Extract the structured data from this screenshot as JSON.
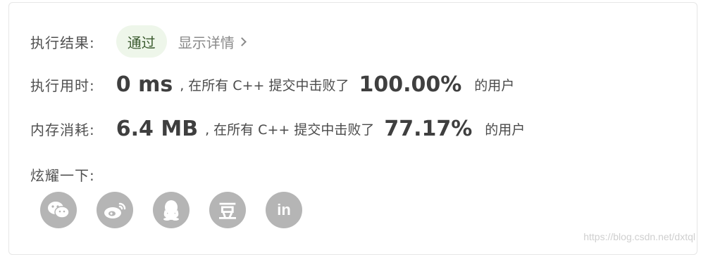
{
  "result": {
    "label": "执行结果:",
    "status": "通过",
    "details_link": "显示详情"
  },
  "runtime": {
    "label": "执行用时:",
    "value": "0 ms",
    "middle_text": ", 在所有 C++ 提交中击败了",
    "percent": "100.00%",
    "suffix": "的用户"
  },
  "memory": {
    "label": "内存消耗:",
    "value": "6.4 MB",
    "middle_text": ", 在所有 C++ 提交中击败了",
    "percent": "77.17%",
    "suffix": "的用户"
  },
  "share": {
    "label": "炫耀一下:",
    "icons": [
      "wechat-icon",
      "weibo-icon",
      "qq-icon",
      "douban-icon",
      "linkedin-icon"
    ],
    "douban_glyph": "豆",
    "linkedin_glyph": "in"
  },
  "watermark": "https://blog.csdn.net/dxtql",
  "colors": {
    "status_pill_bg": "#eef6ea",
    "icon_bg": "#b5b5b5",
    "text": "#4a4a4a"
  }
}
